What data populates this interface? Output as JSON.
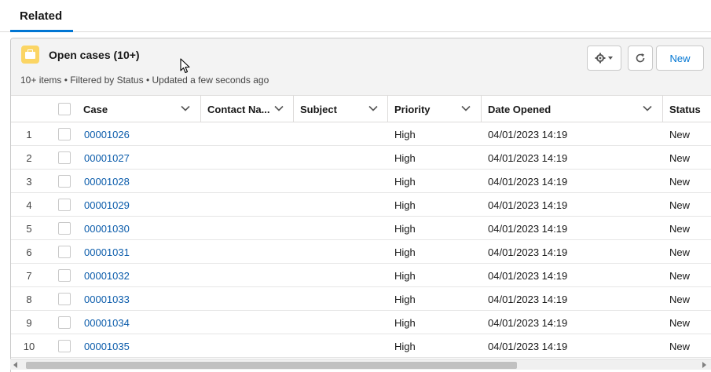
{
  "tabs": {
    "related_label": "Related"
  },
  "card": {
    "title": "Open cases (10+)",
    "subtitle": "10+ items • Filtered by Status • Updated a few seconds ago",
    "icon": "case-briefcase-icon",
    "icon_color": "#fbd564",
    "new_label": "New"
  },
  "columns": [
    {
      "label": "Case"
    },
    {
      "label": "Contact Na..."
    },
    {
      "label": "Subject"
    },
    {
      "label": "Priority"
    },
    {
      "label": "Date Opened"
    },
    {
      "label": "Status"
    }
  ],
  "rows": [
    {
      "num": "1",
      "case": "00001026",
      "contact": "",
      "subject": "",
      "priority": "High",
      "date": "04/01/2023 14:19",
      "status": "New"
    },
    {
      "num": "2",
      "case": "00001027",
      "contact": "",
      "subject": "",
      "priority": "High",
      "date": "04/01/2023 14:19",
      "status": "New"
    },
    {
      "num": "3",
      "case": "00001028",
      "contact": "",
      "subject": "",
      "priority": "High",
      "date": "04/01/2023 14:19",
      "status": "New"
    },
    {
      "num": "4",
      "case": "00001029",
      "contact": "",
      "subject": "",
      "priority": "High",
      "date": "04/01/2023 14:19",
      "status": "New"
    },
    {
      "num": "5",
      "case": "00001030",
      "contact": "",
      "subject": "",
      "priority": "High",
      "date": "04/01/2023 14:19",
      "status": "New"
    },
    {
      "num": "6",
      "case": "00001031",
      "contact": "",
      "subject": "",
      "priority": "High",
      "date": "04/01/2023 14:19",
      "status": "New"
    },
    {
      "num": "7",
      "case": "00001032",
      "contact": "",
      "subject": "",
      "priority": "High",
      "date": "04/01/2023 14:19",
      "status": "New"
    },
    {
      "num": "8",
      "case": "00001033",
      "contact": "",
      "subject": "",
      "priority": "High",
      "date": "04/01/2023 14:19",
      "status": "New"
    },
    {
      "num": "9",
      "case": "00001034",
      "contact": "",
      "subject": "",
      "priority": "High",
      "date": "04/01/2023 14:19",
      "status": "New"
    },
    {
      "num": "10",
      "case": "00001035",
      "contact": "",
      "subject": "",
      "priority": "High",
      "date": "04/01/2023 14:19",
      "status": "New"
    }
  ],
  "colors": {
    "accent": "#0176d3",
    "link": "#0b5cab",
    "border": "#dddbda"
  }
}
